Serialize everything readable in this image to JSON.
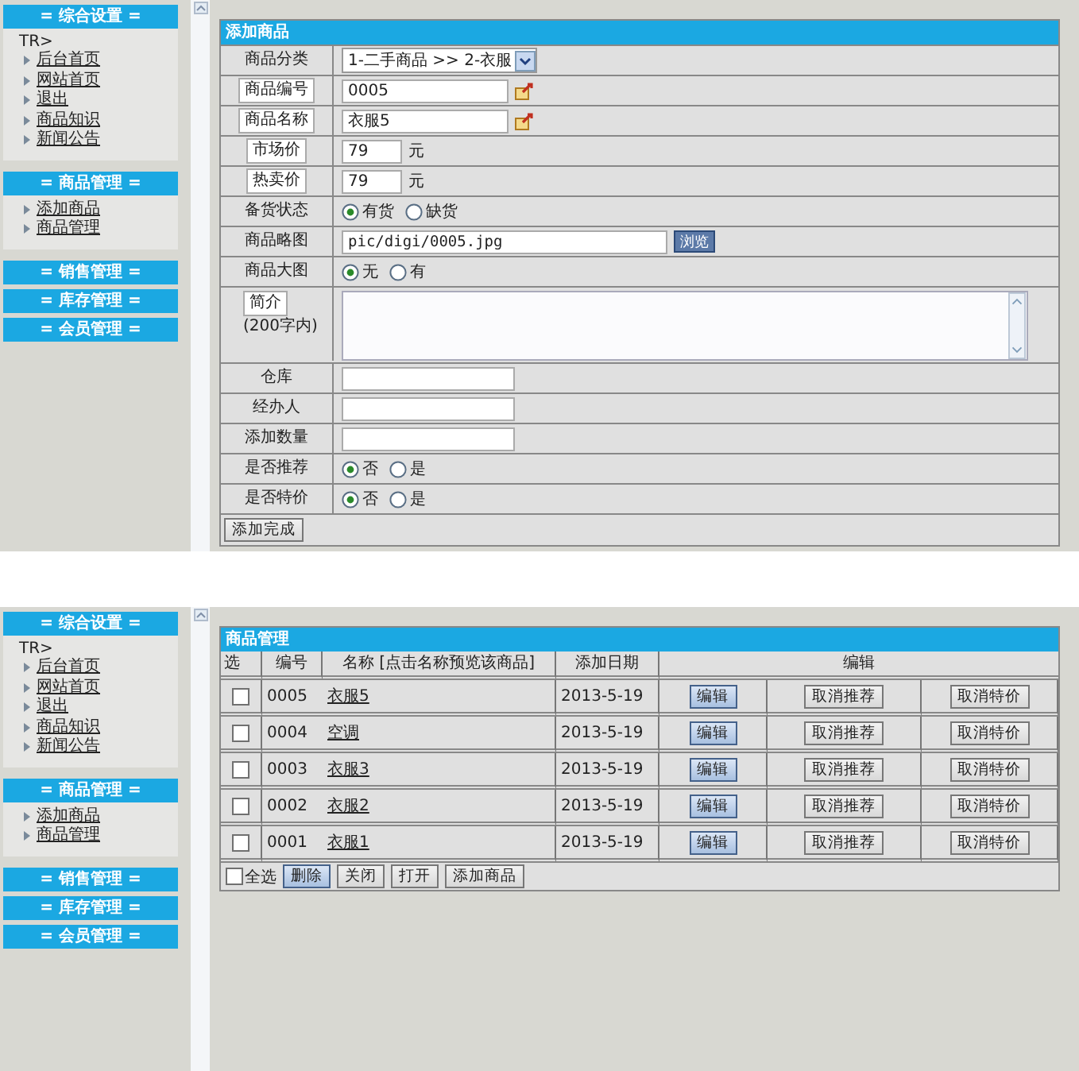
{
  "screens": [
    {
      "kind": "form",
      "sidebar": [
        {
          "title": "= 综合设置 =",
          "prefix": "TR>",
          "items": [
            "后台首页",
            "网站首页",
            "退出",
            "商品知识",
            "新闻公告"
          ]
        },
        {
          "title": "= 商品管理 =",
          "items": [
            "添加商品",
            "商品管理"
          ]
        },
        {
          "title": "= 销售管理 ="
        },
        {
          "title": "= 库存管理 ="
        },
        {
          "title": "= 会员管理 ="
        }
      ],
      "form": {
        "title": "添加商品",
        "rows": [
          {
            "label": "商品分类",
            "boxed": false,
            "kind": "select",
            "value": "1-二手商品 >> 2-衣服"
          },
          {
            "label": "商品编号",
            "boxed": true,
            "kind": "text",
            "value": "0005",
            "picker": true
          },
          {
            "label": "商品名称",
            "boxed": true,
            "kind": "text",
            "value": "衣服5",
            "picker": true
          },
          {
            "label": "市场价",
            "boxed": true,
            "kind": "price",
            "value": "79",
            "unit": "元"
          },
          {
            "label": "热卖价",
            "boxed": true,
            "kind": "price",
            "value": "79",
            "unit": "元"
          },
          {
            "label": "备货状态",
            "boxed": false,
            "kind": "radio",
            "options": [
              {
                "label": "有货",
                "selected": true
              },
              {
                "label": "缺货",
                "selected": false
              }
            ]
          },
          {
            "label": "商品略图",
            "boxed": false,
            "kind": "file",
            "value": "pic/digi/0005.jpg",
            "button": "浏览"
          },
          {
            "label": "商品大图",
            "boxed": false,
            "kind": "radio",
            "options": [
              {
                "label": "无",
                "selected": true
              },
              {
                "label": "有",
                "selected": false
              }
            ]
          },
          {
            "label": "简介",
            "note": "(200字内)",
            "boxed": true,
            "kind": "textarea"
          },
          {
            "label": "仓库",
            "boxed": false,
            "kind": "price"
          },
          {
            "label": "经办人",
            "boxed": false,
            "kind": "price"
          },
          {
            "label": "添加数量",
            "boxed": false,
            "kind": "price"
          },
          {
            "label": "是否推荐",
            "boxed": false,
            "kind": "radio",
            "options": [
              {
                "label": "否",
                "selected": true
              },
              {
                "label": "是",
                "selected": false
              }
            ]
          },
          {
            "label": "是否特价",
            "boxed": false,
            "kind": "radio",
            "options": [
              {
                "label": "否",
                "selected": true
              },
              {
                "label": "是",
                "selected": false
              }
            ]
          }
        ],
        "submit": "添加完成"
      }
    },
    {
      "kind": "table",
      "sidebar": [
        {
          "title": "= 综合设置 =",
          "prefix": "TR>",
          "items": [
            "后台首页",
            "网站首页",
            "退出",
            "商品知识",
            "新闻公告"
          ]
        },
        {
          "title": "= 商品管理 =",
          "items": [
            "添加商品",
            "商品管理"
          ]
        },
        {
          "title": "= 销售管理 ="
        },
        {
          "title": "= 库存管理 ="
        },
        {
          "title": "= 会员管理 ="
        }
      ],
      "table": {
        "title": "商品管理",
        "columns": [
          "选",
          "编号",
          "名称 [点击名称预览该商品]",
          "添加日期",
          "编辑"
        ],
        "rows": [
          {
            "checked": false,
            "id": "0005",
            "name": "衣服5",
            "date": "2013-5-19",
            "actions": [
              "编辑",
              "取消推荐",
              "取消特价"
            ]
          },
          {
            "checked": false,
            "id": "0004",
            "name": "空调",
            "date": "2013-5-19",
            "actions": [
              "编辑",
              "取消推荐",
              "取消特价"
            ]
          },
          {
            "checked": false,
            "id": "0003",
            "name": "衣服3",
            "date": "2013-5-19",
            "actions": [
              "编辑",
              "取消推荐",
              "取消特价"
            ]
          },
          {
            "checked": false,
            "id": "0002",
            "name": "衣服2",
            "date": "2013-5-19",
            "actions": [
              "编辑",
              "取消推荐",
              "取消特价"
            ]
          },
          {
            "checked": false,
            "id": "0001",
            "name": "衣服1",
            "date": "2013-5-19",
            "actions": [
              "编辑",
              "取消推荐",
              "取消特价"
            ]
          }
        ],
        "select_all": {
          "label": "全选",
          "checked": false
        },
        "buttons": [
          "删除",
          "关闭",
          "打开",
          "添加商品"
        ]
      }
    }
  ]
}
